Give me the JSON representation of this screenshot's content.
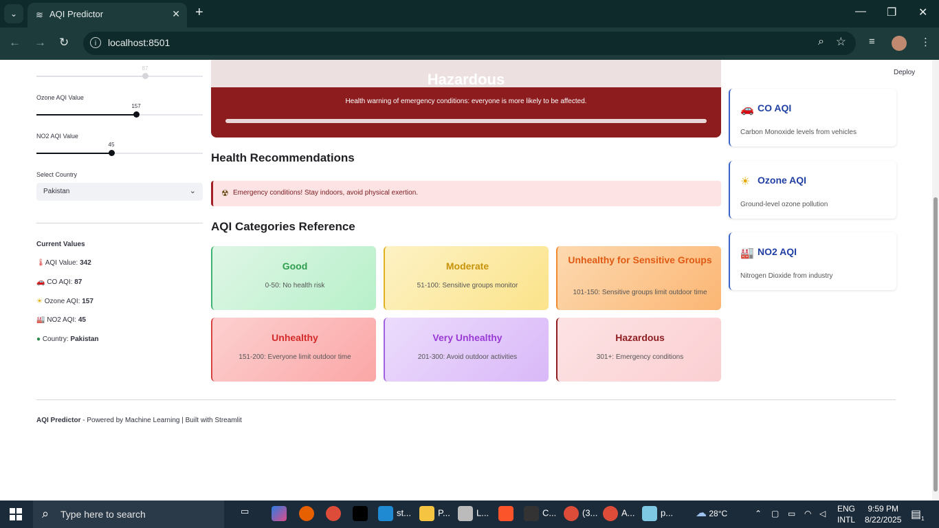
{
  "browser": {
    "tab_title": "AQI Predictor",
    "url": "localhost:8501"
  },
  "app": {
    "deploy_label": "Deploy",
    "sidebar": {
      "partial_slider_value": "87",
      "ozone_label": "Ozone AQI Value",
      "ozone_value": "157",
      "ozone_fraction": 0.6,
      "no2_label": "NO2 AQI Value",
      "no2_value": "45",
      "no2_fraction": 0.45,
      "country_label": "Select Country",
      "country_value": "Pakistan",
      "current_values_heading": "Current Values",
      "current": {
        "aqi_label": "AQI Value: ",
        "aqi_value": "342",
        "co_label": "CO AQI: ",
        "co_value": "87",
        "ozone_label": "Ozone AQI: ",
        "ozone_value": "157",
        "no2_label": "NO2 AQI: ",
        "no2_value": "45",
        "country_label": "Country: ",
        "country_value": "Pakistan"
      }
    },
    "result": {
      "category": "Hazardous",
      "warning": "Health warning of emergency conditions: everyone is more likely to be affected."
    },
    "health": {
      "heading": "Health Recommendations",
      "alert_text": "Emergency conditions! Stay indoors, avoid physical exertion."
    },
    "reference": {
      "heading": "AQI Categories Reference",
      "cards": [
        {
          "title": "Good",
          "desc": "0-50: No health risk",
          "color": "#2e9e4f"
        },
        {
          "title": "Moderate",
          "desc": "51-100: Sensitive groups monitor",
          "color": "#c8920a"
        },
        {
          "title": "Unhealthy for Sensitive Groups",
          "desc": "101-150: Sensitive groups limit outdoor time",
          "color": "#e05a14"
        },
        {
          "title": "Unhealthy",
          "desc": "151-200: Everyone limit outdoor time",
          "color": "#d42a2a"
        },
        {
          "title": "Very Unhealthy",
          "desc": "201-300: Avoid outdoor activities",
          "color": "#9a3ad6"
        },
        {
          "title": "Hazardous",
          "desc": "301+: Emergency conditions",
          "color": "#8d1c1f"
        }
      ]
    },
    "pollutants": [
      {
        "icon": "car-icon",
        "title": "CO AQI",
        "desc": "Carbon Monoxide levels from vehicles"
      },
      {
        "icon": "sun-icon",
        "title": "Ozone AQI",
        "desc": "Ground-level ozone pollution"
      },
      {
        "icon": "factory-icon",
        "title": "NO2 AQI",
        "desc": "Nitrogen Dioxide from industry"
      }
    ],
    "footer": {
      "brand": "AQI Predictor",
      "text": " - Powered by Machine Learning | Built with Streamlit"
    }
  },
  "taskbar": {
    "search_placeholder": "Type here to search",
    "apps": [
      "st...",
      "P...",
      "L...",
      "C...",
      "(3...",
      "A...",
      "p..."
    ],
    "weather": "28°C",
    "lang_top": "ENG",
    "lang_bottom": "INTL",
    "time": "9:59 PM",
    "date": "8/22/2025",
    "notification_count": "1"
  }
}
